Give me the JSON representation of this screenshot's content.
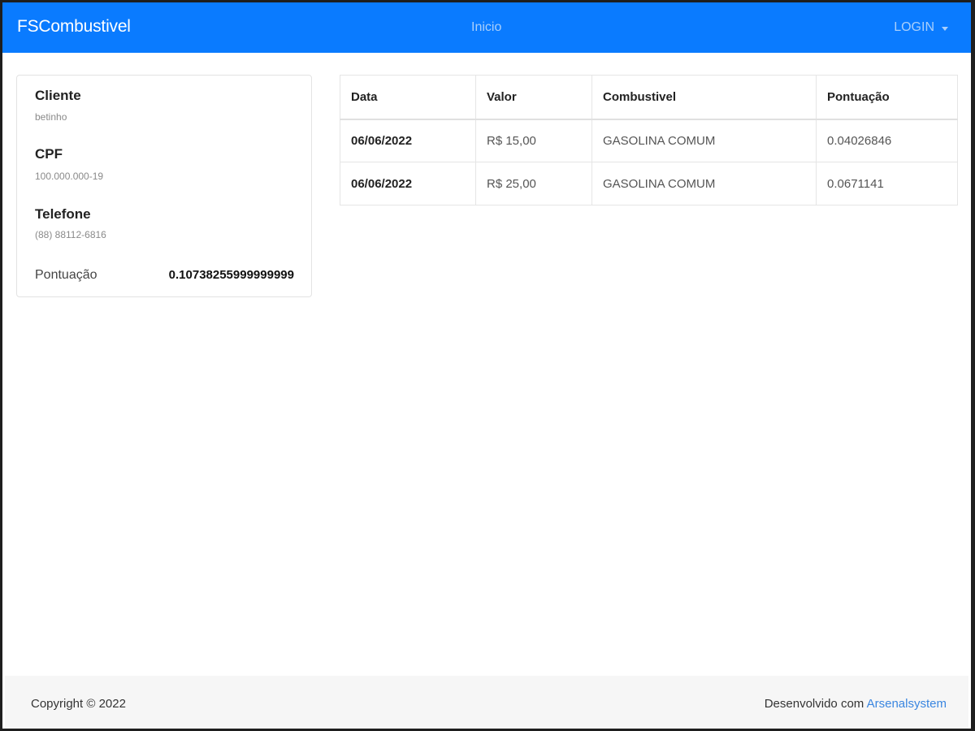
{
  "navbar": {
    "brand": "FSCombustivel",
    "inicio": "Inicio",
    "login": "LOGIN"
  },
  "client": {
    "name_label": "Cliente",
    "name_value": "betinho",
    "cpf_label": "CPF",
    "cpf_value": "100.000.000-19",
    "phone_label": "Telefone",
    "phone_value": "(88) 88112-6816",
    "score_label": "Pontuação",
    "score_value": "0.10738255999999999"
  },
  "table": {
    "headers": [
      "Data",
      "Valor",
      "Combustivel",
      "Pontuação"
    ],
    "rows": [
      [
        "06/06/2022",
        "R$ 15,00",
        "GASOLINA COMUM",
        "0.04026846"
      ],
      [
        "06/06/2022",
        "R$ 25,00",
        "GASOLINA COMUM",
        "0.0671141"
      ]
    ]
  },
  "footer": {
    "copyright": "Copyright © 2022",
    "developed_prefix": "Desenvolvido com",
    "developed_link": "Arsenalsystem"
  },
  "colors": {
    "navbar_bg": "#0a7bff",
    "link": "#3a86e0"
  }
}
